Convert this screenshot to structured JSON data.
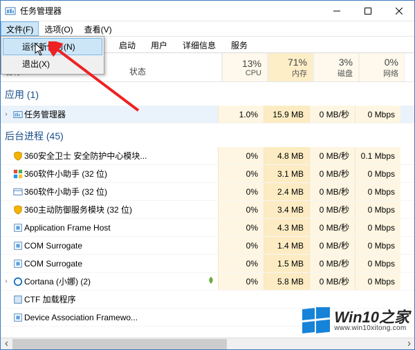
{
  "window": {
    "title": "任务管理器"
  },
  "menubar": {
    "file": "文件(F)",
    "options": "选项(O)",
    "view": "查看(V)"
  },
  "file_menu": {
    "run": "运行新任务(N)",
    "exit": "退出(X)"
  },
  "tabs": {
    "t4": "启动",
    "t5": "用户",
    "t6": "详细信息",
    "t7": "服务"
  },
  "columns": {
    "name": "名称",
    "status": "状态",
    "cpu_pct": "13%",
    "cpu_lbl": "CPU",
    "mem_pct": "71%",
    "mem_lbl": "内存",
    "disk_pct": "3%",
    "disk_lbl": "磁盘",
    "net_pct": "0%",
    "net_lbl": "网络"
  },
  "groups": {
    "apps": "应用 (1)",
    "bg": "后台进程 (45)"
  },
  "rows": {
    "r0": {
      "name": "任务管理器",
      "cpu": "1.0%",
      "mem": "15.9 MB",
      "disk": "0 MB/秒",
      "net": "0 Mbps"
    },
    "r1": {
      "name": "360安全卫士 安全防护中心模块...",
      "cpu": "0%",
      "mem": "4.8 MB",
      "disk": "0 MB/秒",
      "net": "0.1 Mbps"
    },
    "r2": {
      "name": "360软件小助手 (32 位)",
      "cpu": "0%",
      "mem": "3.1 MB",
      "disk": "0 MB/秒",
      "net": "0 Mbps"
    },
    "r3": {
      "name": "360软件小助手 (32 位)",
      "cpu": "0%",
      "mem": "2.4 MB",
      "disk": "0 MB/秒",
      "net": "0 Mbps"
    },
    "r4": {
      "name": "360主动防御服务模块 (32 位)",
      "cpu": "0%",
      "mem": "3.4 MB",
      "disk": "0 MB/秒",
      "net": "0 Mbps"
    },
    "r5": {
      "name": "Application Frame Host",
      "cpu": "0%",
      "mem": "4.3 MB",
      "disk": "0 MB/秒",
      "net": "0 Mbps"
    },
    "r6": {
      "name": "COM Surrogate",
      "cpu": "0%",
      "mem": "1.4 MB",
      "disk": "0 MB/秒",
      "net": "0 Mbps"
    },
    "r7": {
      "name": "COM Surrogate",
      "cpu": "0%",
      "mem": "1.5 MB",
      "disk": "0 MB/秒",
      "net": "0 Mbps"
    },
    "r8": {
      "name": "Cortana (小娜) (2)",
      "cpu": "0%",
      "mem": "5.8 MB",
      "disk": "0 MB/秒",
      "net": "0 Mbps"
    },
    "r9": {
      "name": "CTF 加载程序"
    },
    "r10": {
      "name": "Device Association Framewo..."
    }
  },
  "watermark": {
    "brand": "Win10之家",
    "url": "www.win10xitong.com"
  }
}
